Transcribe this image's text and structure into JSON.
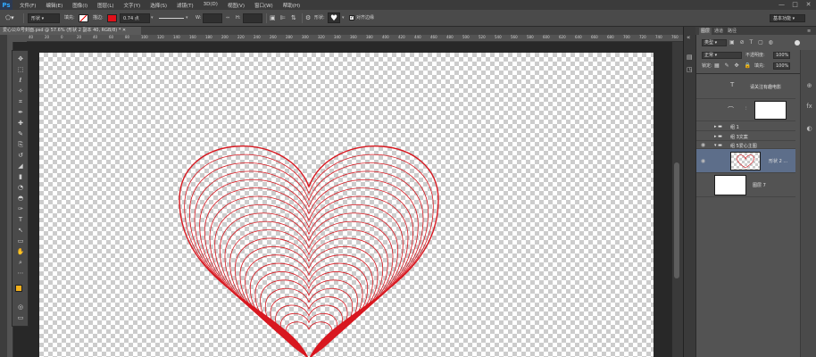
{
  "app": {
    "logo": "Ps"
  },
  "menu": [
    "文件(F)",
    "编辑(E)",
    "图像(I)",
    "图层(L)",
    "文字(Y)",
    "选择(S)",
    "滤镜(T)",
    "3D(D)",
    "视图(V)",
    "窗口(W)",
    "帮助(H)"
  ],
  "window_buttons": [
    "—",
    "□",
    "✕"
  ],
  "options": {
    "mode_value": "形状",
    "fill_label": "填充:",
    "stroke_label": "描边:",
    "stroke_width": "0.74 点",
    "w_label": "W:",
    "h_label": "H:",
    "align_edges_label": "对齐边缘",
    "shape_label": "形状:",
    "workspace": "基本功能"
  },
  "colors": {
    "fill": "#ffffff",
    "stroke": "#e0101a",
    "heart": "#d81820",
    "foreground": "#f3b01b"
  },
  "document_tab": {
    "title": "爱心公众号封面.psd @ 57.6% (形状 2 副本 40, RGB/8) *"
  },
  "ruler_ticks": [
    "40",
    "20",
    "0",
    "20",
    "40",
    "60",
    "80",
    "100",
    "120",
    "140",
    "160",
    "180",
    "200",
    "220",
    "240",
    "260",
    "280",
    "300",
    "320",
    "340",
    "360",
    "380",
    "400",
    "420",
    "440",
    "460",
    "480",
    "500",
    "520",
    "540",
    "560",
    "580",
    "600",
    "620",
    "640",
    "660",
    "680",
    "700",
    "720",
    "740",
    "760"
  ],
  "tools": [
    "move-tool",
    "marquee-tool",
    "lasso-tool",
    "quick-select-tool",
    "crop-tool",
    "eyedropper-tool",
    "healing-tool",
    "brush-tool",
    "clone-tool",
    "history-brush-tool",
    "eraser-tool",
    "gradient-tool",
    "blur-tool",
    "dodge-tool",
    "pen-tool",
    "type-tool",
    "path-select-tool",
    "shape-tool",
    "hand-tool",
    "zoom-tool",
    "edit-toolbar-tool"
  ],
  "layers_panel": {
    "tabs": [
      "图层",
      "通道",
      "路径"
    ],
    "filter_label": "类型",
    "blend_mode": "正常",
    "opacity_label": "不透明度:",
    "opacity": "100%",
    "lock_label": "锁定:",
    "fill_label": "填充:",
    "fill": "100%",
    "layers": [
      {
        "kind": "text",
        "icon": "T",
        "name": "请关注有趣电影"
      },
      {
        "kind": "shape",
        "name": ""
      },
      {
        "kind": "group",
        "name": "组 1"
      },
      {
        "kind": "group",
        "name": "组 3文案"
      },
      {
        "kind": "group-open",
        "name": "组 5爱心主图"
      },
      {
        "kind": "shape-selected",
        "name": "形状 2 ..."
      },
      {
        "kind": "pixel",
        "name": "图层 7"
      }
    ]
  }
}
